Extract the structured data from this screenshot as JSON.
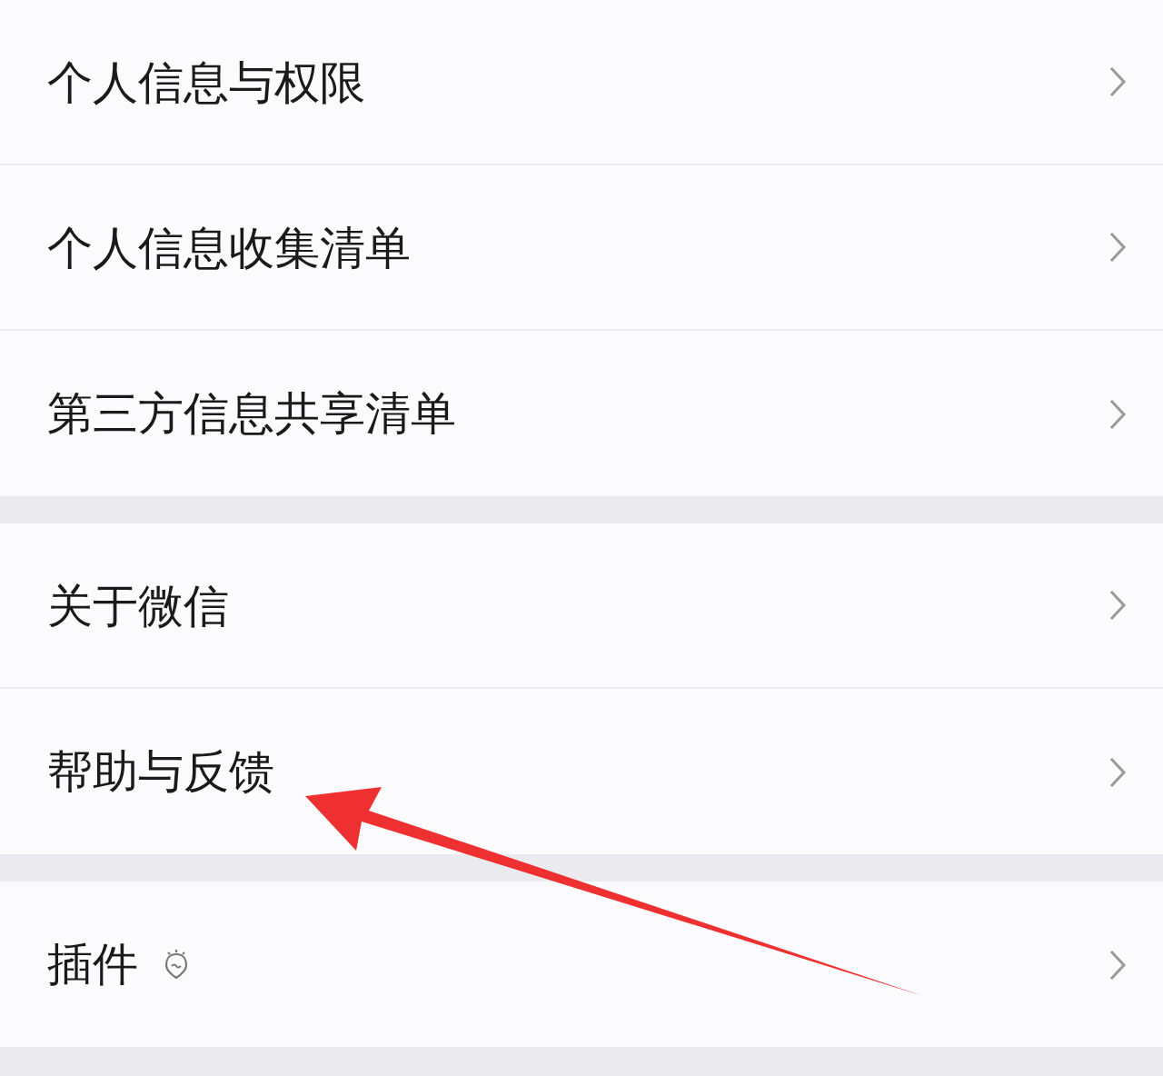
{
  "groups": [
    {
      "items": [
        {
          "kind": "plain",
          "label": "个人信息与权限"
        },
        {
          "kind": "plain",
          "label": "个人信息收集清单"
        },
        {
          "kind": "plain",
          "label": "第三方信息共享清单"
        }
      ]
    },
    {
      "items": [
        {
          "kind": "plain",
          "label": "关于微信"
        },
        {
          "kind": "plain",
          "label": "帮助与反馈"
        }
      ]
    },
    {
      "items": [
        {
          "kind": "with-icon",
          "label": "插件"
        }
      ]
    }
  ]
}
